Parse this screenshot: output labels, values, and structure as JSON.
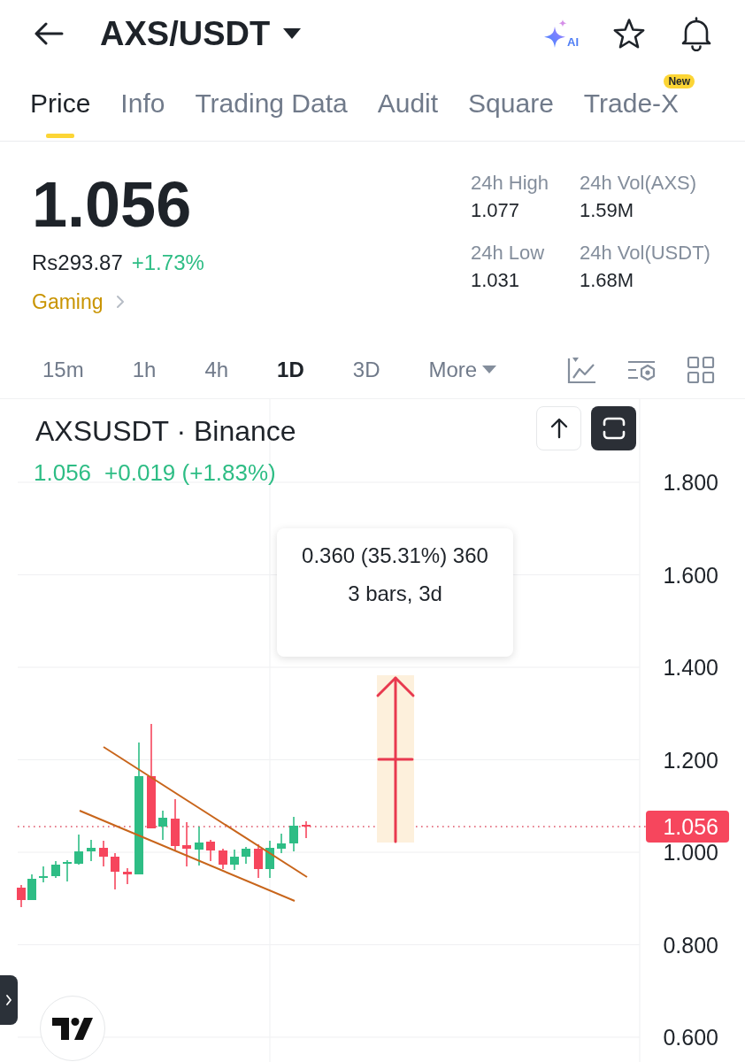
{
  "header": {
    "title": "AXS/USDT",
    "ai_label": "AI"
  },
  "tabs": [
    {
      "label": "Price",
      "selected": true
    },
    {
      "label": "Info",
      "selected": false
    },
    {
      "label": "Trading Data",
      "selected": false
    },
    {
      "label": "Audit",
      "selected": false
    },
    {
      "label": "Square",
      "selected": false
    },
    {
      "label": "Trade-X",
      "selected": false,
      "badge": "New"
    }
  ],
  "price_panel": {
    "last_price": "1.056",
    "fiat_price": "Rs293.87",
    "change": "+1.73%",
    "category": "Gaming"
  },
  "stats": [
    {
      "label": "24h High",
      "value": "1.077"
    },
    {
      "label": "24h Vol(AXS)",
      "value": "1.59M"
    },
    {
      "label": "24h Low",
      "value": "1.031"
    },
    {
      "label": "24h Vol(USDT)",
      "value": "1.68M"
    }
  ],
  "timeframes": [
    {
      "label": "15m",
      "selected": false
    },
    {
      "label": "1h",
      "selected": false
    },
    {
      "label": "4h",
      "selected": false
    },
    {
      "label": "1D",
      "selected": true
    },
    {
      "label": "3D",
      "selected": false
    }
  ],
  "more_menu": "More",
  "chart": {
    "symbol": "AXSUSDT · Binance",
    "last_price": "1.056",
    "change": "+0.019 (+1.83%)",
    "measurement": [
      "0.360 (35.31%) 360",
      "3 bars, 3d"
    ],
    "price_axis": [
      "1.800",
      "1.600",
      "1.400",
      "1.200",
      "1.000",
      "0.800",
      "0.600"
    ],
    "price_tag": "1.056"
  }
}
